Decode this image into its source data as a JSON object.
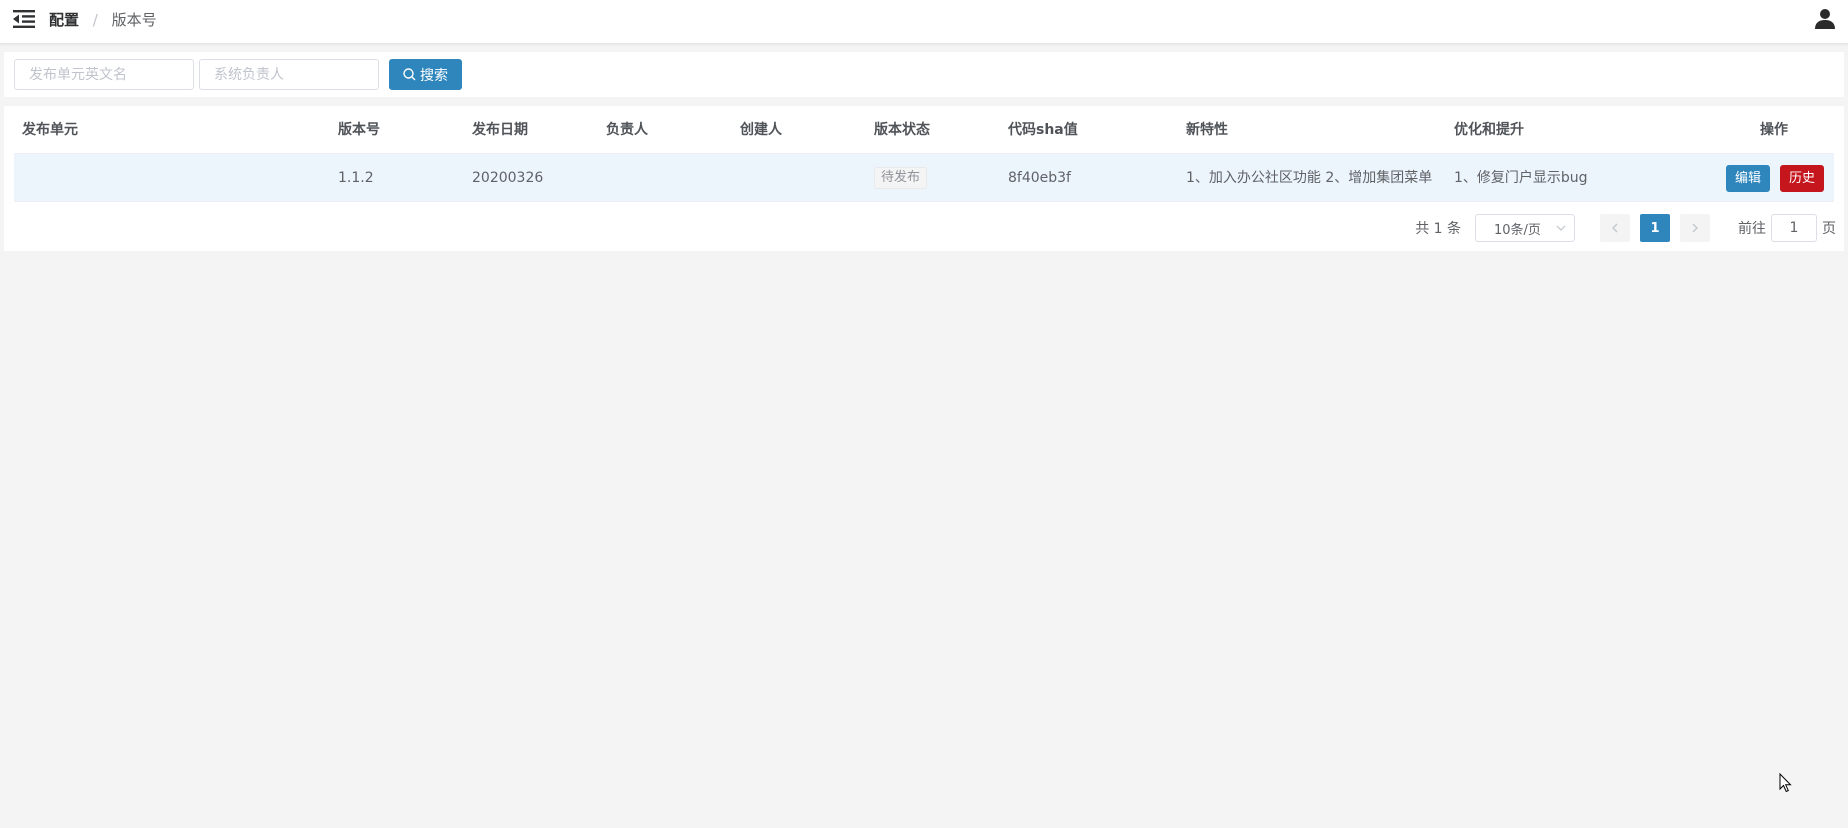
{
  "header": {
    "breadcrumb_root": "配置",
    "breadcrumb_separator": "/",
    "breadcrumb_current": "版本号",
    "menu_icon": "menu-fold-icon",
    "user_icon": "user-icon"
  },
  "search": {
    "unit_placeholder": "发布单元英文名",
    "owner_placeholder": "系统负责人",
    "button_label": "搜索",
    "button_icon": "search-icon"
  },
  "table": {
    "columns": [
      "发布单元",
      "版本号",
      "发布日期",
      "负责人",
      "创建人",
      "版本状态",
      "代码sha值",
      "新特性",
      "优化和提升",
      "操作"
    ],
    "rows": [
      {
        "unit": "",
        "version": "1.1.2",
        "date": "20200326",
        "owner": "",
        "creator": "",
        "status": "待发布",
        "sha": "8f40eb3f",
        "features": "1、加入办公社区功能 2、增加集团菜单",
        "improvements": "1、修复门户显示bug",
        "edit_label": "编辑",
        "history_label": "历史"
      }
    ]
  },
  "pagination": {
    "total_text": "共 1 条",
    "page_size": "10条/页",
    "current_page": "1",
    "goto_prefix": "前往",
    "goto_value": "1",
    "goto_suffix": "页"
  },
  "colors": {
    "primary": "#2f86bd",
    "danger": "#c4161c",
    "row_highlight": "#ecf5fc",
    "background": "#f4f4f4"
  }
}
